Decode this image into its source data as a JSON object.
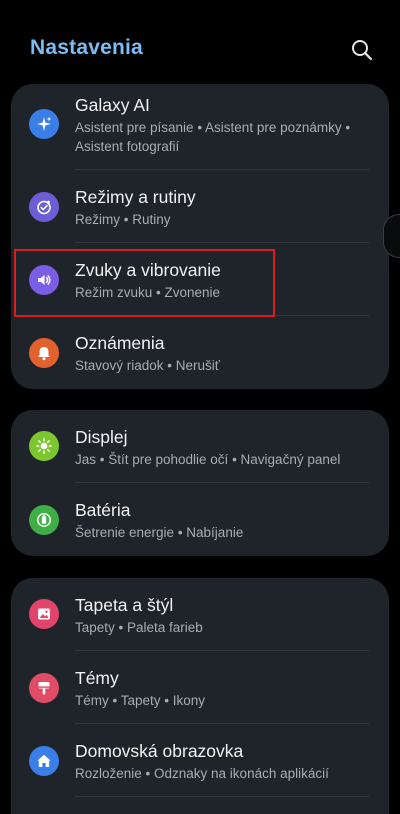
{
  "header": {
    "title": "Nastavenia",
    "search_icon": "search-icon"
  },
  "colors": {
    "title_accent": "#7cbcf5",
    "card_bg": "#1f232a",
    "highlight_border": "#d81e1e"
  },
  "groups": [
    {
      "items": [
        {
          "title": "Galaxy AI",
          "subtitle": "Asistent pre písanie • Asistent pre poznámky • Asistent fotografií",
          "icon": "sparkle-icon",
          "icon_color": "#3a7ee8"
        },
        {
          "title": "Režimy a rutiny",
          "subtitle": "Režimy • Rutiny",
          "icon": "routine-check-icon",
          "icon_color": "#6e5ed6"
        },
        {
          "title": "Zvuky a vibrovanie",
          "subtitle": "Režim zvuku • Zvonenie",
          "icon": "speaker-icon",
          "icon_color": "#7a5ee6"
        },
        {
          "title": "Oznámenia",
          "subtitle": "Stavový riadok • Nerušiť",
          "icon": "bell-icon",
          "icon_color": "#e2622e"
        }
      ]
    },
    {
      "items": [
        {
          "title": "Displej",
          "subtitle": "Jas • Štít pre pohodlie očí • Navigačný panel",
          "icon": "sun-icon",
          "icon_color": "#7cc62e"
        },
        {
          "title": "Batéria",
          "subtitle": "Šetrenie energie • Nabíjanie",
          "icon": "battery-icon",
          "icon_color": "#3fae45"
        }
      ]
    },
    {
      "items": [
        {
          "title": "Tapeta a štýl",
          "subtitle": "Tapety • Paleta farieb",
          "icon": "image-icon",
          "icon_color": "#e2456a"
        },
        {
          "title": "Témy",
          "subtitle": "Témy • Tapety • Ikony",
          "icon": "brush-icon",
          "icon_color": "#e04b66"
        },
        {
          "title": "Domovská obrazovka",
          "subtitle": "Rozloženie • Odznaky na ikonách aplikácií",
          "icon": "home-icon",
          "icon_color": "#3a7ee8"
        }
      ]
    }
  ]
}
